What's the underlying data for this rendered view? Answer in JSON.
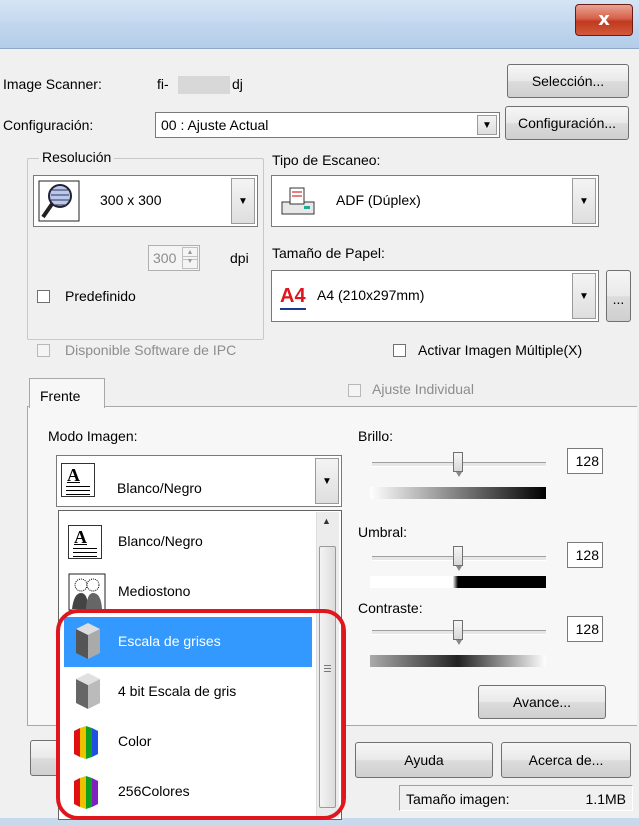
{
  "window": {
    "close_glyph": "x"
  },
  "scanner": {
    "label": "Image Scanner:",
    "value_prefix": "fi-",
    "value_suffix": "dj",
    "select_button": "Selección..."
  },
  "config": {
    "label": "Configuración:",
    "value": "00 : Ajuste Actual",
    "button": "Configuración..."
  },
  "resolution": {
    "group_label": "Resolución",
    "value": "300 x 300",
    "spin_value": "300",
    "unit": "dpi",
    "predefined_label": "Predefinido"
  },
  "scan_type": {
    "label": "Tipo de Escaneo:",
    "value": "ADF (Dúplex)"
  },
  "paper": {
    "label": "Tamaño de Papel:",
    "icon_text": "A4",
    "value": "A4 (210x297mm)",
    "more_button": "..."
  },
  "ipc": {
    "label": "Disponible  Software de IPC"
  },
  "multi_image": {
    "label": "Activar Imagen Múltiple(X)"
  },
  "tabs": {
    "front": "Frente",
    "individual": "Ajuste Individual"
  },
  "mode": {
    "label": "Modo Imagen:",
    "value": "Blanco/Negro",
    "options": [
      "Blanco/Negro",
      "Mediostono",
      "Escala de grises",
      "4 bit Escala de gris",
      "Color",
      "256Colores"
    ],
    "selected": "Escala de grises"
  },
  "brightness": {
    "label": "Brillo:",
    "value": "128"
  },
  "threshold": {
    "label": "Umbral:",
    "value": "128"
  },
  "contrast": {
    "label": "Contraste:",
    "value": "128"
  },
  "buttons": {
    "advance": "Avance...",
    "help": "Ayuda",
    "about": "Acerca de..."
  },
  "status": {
    "size_label": "Tamaño imagen:",
    "size_value": "1.1MB"
  },
  "colors": {
    "highlight": "#3399ff",
    "annotation": "#e0161e"
  }
}
